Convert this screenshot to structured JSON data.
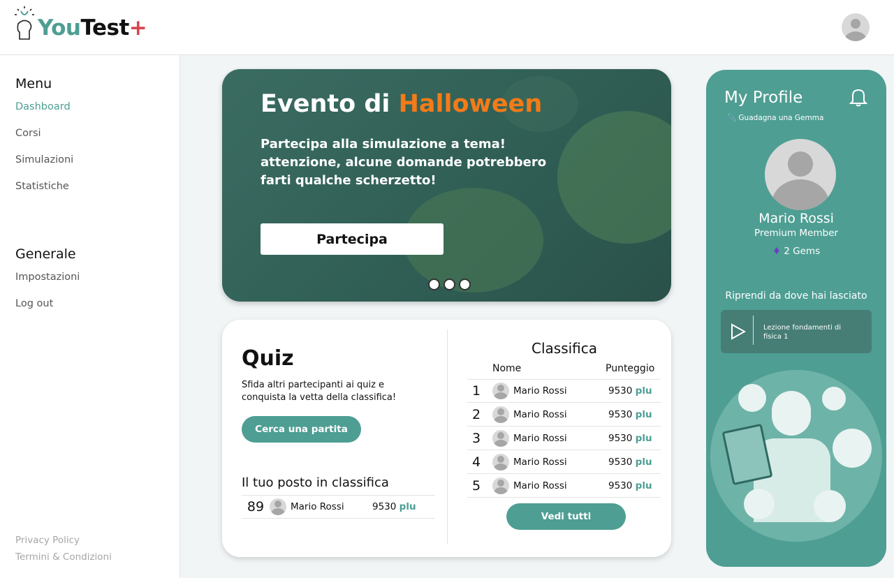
{
  "header": {
    "logo_you": "You",
    "logo_test": "Test",
    "logo_plus": "+"
  },
  "sidebar": {
    "menu_title": "Menu",
    "menu": [
      "Dashboard",
      "Corsi",
      "Simulazioni",
      "Statistiche"
    ],
    "general_title": "Generale",
    "general": [
      "Impostazioni",
      "Log out"
    ],
    "footer": [
      "Privacy Policy",
      "Termini & Condizioni"
    ]
  },
  "banner": {
    "title_prefix": "Evento di ",
    "title_highlight": "Halloween",
    "text": "Partecipa alla simulazione a tema! attenzione, alcune domande potrebbero farti qualche scherzetto!",
    "button": "Partecipa",
    "slides": 3,
    "active_slide": 1
  },
  "quiz": {
    "title": "Quiz",
    "description": "Sfida altri partecipanti ai quiz e conquista la vetta della classifica!",
    "search_button": "Cerca una partita",
    "my_rank_title": "Il tuo posto in classifica",
    "my_rank": {
      "rank": "89",
      "name": "Mario Rossi",
      "score": "9530",
      "unit": "plu"
    }
  },
  "leaderboard": {
    "title": "Classifica",
    "col_name": "Nome",
    "col_score": "Punteggio",
    "rows": [
      {
        "rank": "1",
        "name": "Mario Rossi",
        "score": "9530",
        "unit": "plu"
      },
      {
        "rank": "2",
        "name": "Mario Rossi",
        "score": "9530",
        "unit": "plu"
      },
      {
        "rank": "3",
        "name": "Mario Rossi",
        "score": "9530",
        "unit": "plu"
      },
      {
        "rank": "4",
        "name": "Mario Rossi",
        "score": "9530",
        "unit": "plu"
      },
      {
        "rank": "5",
        "name": "Mario Rossi",
        "score": "9530",
        "unit": "plu"
      }
    ],
    "view_all": "Vedi tutti"
  },
  "profile": {
    "title": "My Profile",
    "earn_gem": "Guadagna una Gemma",
    "name": "Mario Rossi",
    "membership": "Premium Member",
    "gems": "2 Gems",
    "resume_title": "Riprendi da dove hai lasciato",
    "lesson": "Lezione fondamenti di fisica 1"
  }
}
